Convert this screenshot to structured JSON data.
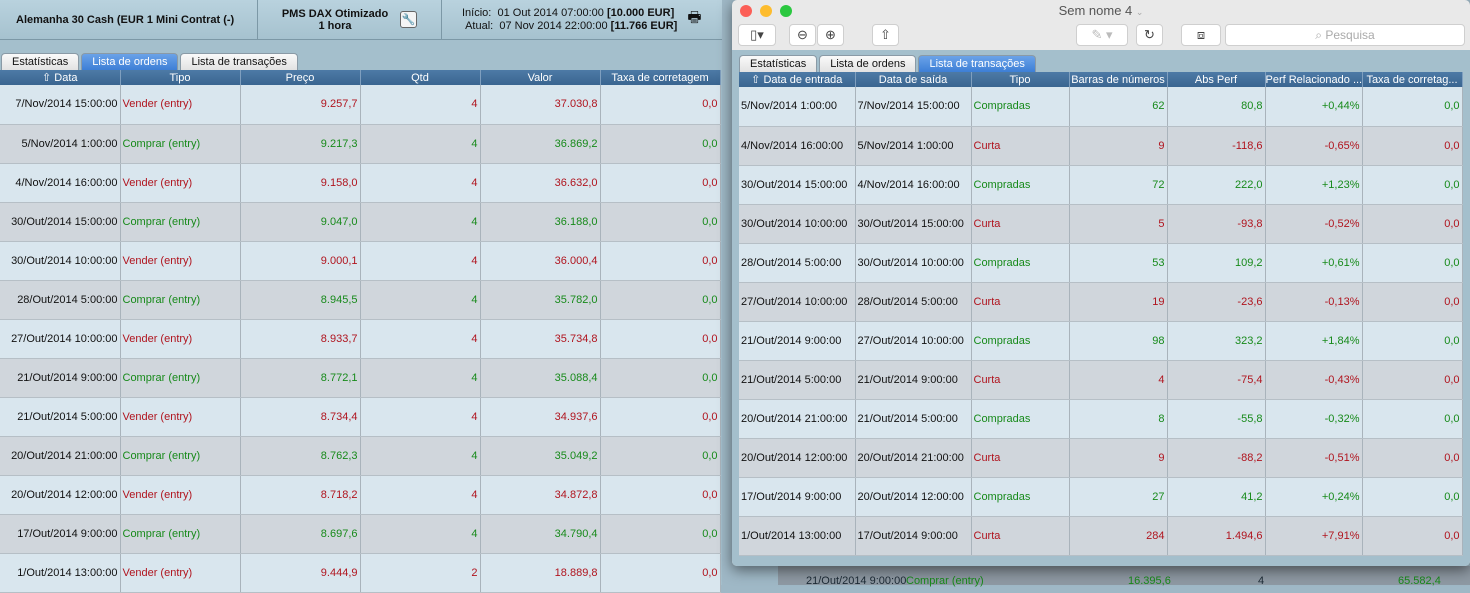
{
  "left": {
    "instrument": "Alemanha 30 Cash (EUR 1 Mini Contrat (-)",
    "strategy": "PMS DAX Otimizado",
    "timeframe": "1 hora",
    "start_label": "Início:",
    "start_date": "01 Out 2014 07:00:00",
    "start_value": "[10.000 EUR]",
    "current_label": "Atual:",
    "current_date": "07 Nov 2014 22:00:00",
    "current_value": "[11.766 EUR]",
    "tabs": [
      "Estatísticas",
      "Lista de ordens",
      "Lista de transações"
    ],
    "columns": [
      "Data",
      "Tipo",
      "Preço",
      "Qtd",
      "Valor",
      "Taxa de corretagem"
    ],
    "rows": [
      [
        "7/Nov/2014 15:00:00",
        "Vender (entry)",
        "9.257,7",
        "4",
        "37.030,8",
        "0,0"
      ],
      [
        "5/Nov/2014 1:00:00",
        "Comprar (entry)",
        "9.217,3",
        "4",
        "36.869,2",
        "0,0"
      ],
      [
        "4/Nov/2014 16:00:00",
        "Vender (entry)",
        "9.158,0",
        "4",
        "36.632,0",
        "0,0"
      ],
      [
        "30/Out/2014 15:00:00",
        "Comprar (entry)",
        "9.047,0",
        "4",
        "36.188,0",
        "0,0"
      ],
      [
        "30/Out/2014 10:00:00",
        "Vender (entry)",
        "9.000,1",
        "4",
        "36.000,4",
        "0,0"
      ],
      [
        "28/Out/2014 5:00:00",
        "Comprar (entry)",
        "8.945,5",
        "4",
        "35.782,0",
        "0,0"
      ],
      [
        "27/Out/2014 10:00:00",
        "Vender (entry)",
        "8.933,7",
        "4",
        "35.734,8",
        "0,0"
      ],
      [
        "21/Out/2014 9:00:00",
        "Comprar (entry)",
        "8.772,1",
        "4",
        "35.088,4",
        "0,0"
      ],
      [
        "21/Out/2014 5:00:00",
        "Vender (entry)",
        "8.734,4",
        "4",
        "34.937,6",
        "0,0"
      ],
      [
        "20/Out/2014 21:00:00",
        "Comprar (entry)",
        "8.762,3",
        "4",
        "35.049,2",
        "0,0"
      ],
      [
        "20/Out/2014 12:00:00",
        "Vender (entry)",
        "8.718,2",
        "4",
        "34.872,8",
        "0,0"
      ],
      [
        "17/Out/2014 9:00:00",
        "Comprar (entry)",
        "8.697,6",
        "4",
        "34.790,4",
        "0,0"
      ],
      [
        "1/Out/2014 13:00:00",
        "Vender (entry)",
        "9.444,9",
        "2",
        "18.889,8",
        "0,0"
      ]
    ]
  },
  "behind": {
    "row": [
      "21/Out/2014 9:00:00",
      "Comprar (entry)",
      "16.395,6",
      "4",
      "65.582,4"
    ]
  },
  "right": {
    "title": "Sem nome 4",
    "search_placeholder": "Pesquisa",
    "tabs": [
      "Estatísticas",
      "Lista de ordens",
      "Lista de transações"
    ],
    "columns": [
      "Data de entrada",
      "Data de saída",
      "Tipo",
      "Barras de números",
      "Abs Perf",
      "Perf Relacionado ...",
      "Taxa de corretag..."
    ],
    "rows": [
      [
        "5/Nov/2014 1:00:00",
        "7/Nov/2014 15:00:00",
        "Compradas",
        "62",
        "80,8",
        "+0,44%",
        "0,0"
      ],
      [
        "4/Nov/2014 16:00:00",
        "5/Nov/2014 1:00:00",
        "Curta",
        "9",
        "-118,6",
        "-0,65%",
        "0,0"
      ],
      [
        "30/Out/2014 15:00:00",
        "4/Nov/2014 16:00:00",
        "Compradas",
        "72",
        "222,0",
        "+1,23%",
        "0,0"
      ],
      [
        "30/Out/2014 10:00:00",
        "30/Out/2014 15:00:00",
        "Curta",
        "5",
        "-93,8",
        "-0,52%",
        "0,0"
      ],
      [
        "28/Out/2014 5:00:00",
        "30/Out/2014 10:00:00",
        "Compradas",
        "53",
        "109,2",
        "+0,61%",
        "0,0"
      ],
      [
        "27/Out/2014 10:00:00",
        "28/Out/2014 5:00:00",
        "Curta",
        "19",
        "-23,6",
        "-0,13%",
        "0,0"
      ],
      [
        "21/Out/2014 9:00:00",
        "27/Out/2014 10:00:00",
        "Compradas",
        "98",
        "323,2",
        "+1,84%",
        "0,0"
      ],
      [
        "21/Out/2014 5:00:00",
        "21/Out/2014 9:00:00",
        "Curta",
        "4",
        "-75,4",
        "-0,43%",
        "0,0"
      ],
      [
        "20/Out/2014 21:00:00",
        "21/Out/2014 5:00:00",
        "Compradas",
        "8",
        "-55,8",
        "-0,32%",
        "0,0"
      ],
      [
        "20/Out/2014 12:00:00",
        "20/Out/2014 21:00:00",
        "Curta",
        "9",
        "-88,2",
        "-0,51%",
        "0,0"
      ],
      [
        "17/Out/2014 9:00:00",
        "20/Out/2014 12:00:00",
        "Compradas",
        "27",
        "41,2",
        "+0,24%",
        "0,0"
      ],
      [
        "1/Out/2014 13:00:00",
        "17/Out/2014 9:00:00",
        "Curta",
        "284",
        "1.494,6",
        "+7,91%",
        "0,0"
      ]
    ]
  },
  "colors": {
    "red": "#b0141e",
    "green": "#178a1a",
    "header": "#3f6a96",
    "active_tab": "#4a88dc"
  }
}
